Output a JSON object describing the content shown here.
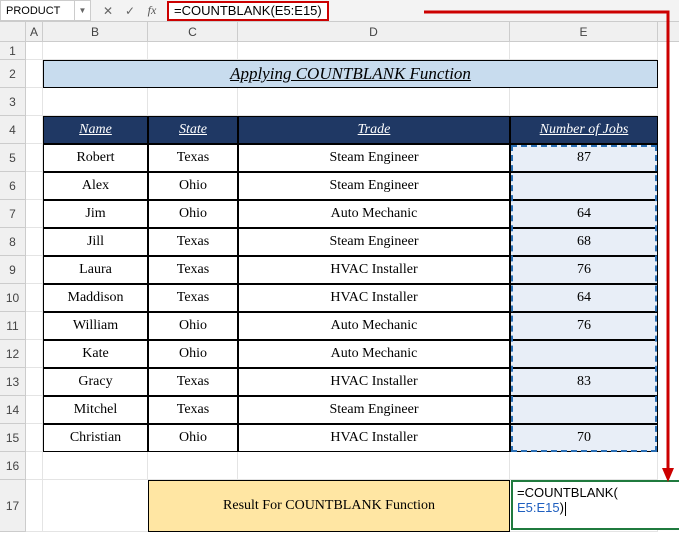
{
  "name_box": "PRODUCT",
  "formula_bar": "=COUNTBLANK(E5:E15)",
  "columns": [
    "A",
    "B",
    "C",
    "D",
    "E"
  ],
  "rows": [
    "1",
    "2",
    "3",
    "4",
    "5",
    "6",
    "7",
    "8",
    "9",
    "10",
    "11",
    "12",
    "13",
    "14",
    "15",
    "16",
    "17"
  ],
  "title": "Applying COUNTBLANK Function",
  "headers": {
    "b": "Name",
    "c": "State",
    "d": "Trade",
    "e": "Number of Jobs"
  },
  "data": [
    {
      "name": "Robert",
      "state": "Texas",
      "trade": "Steam Engineer",
      "jobs": "87"
    },
    {
      "name": "Alex",
      "state": "Ohio",
      "trade": "Steam Engineer",
      "jobs": ""
    },
    {
      "name": "Jim",
      "state": "Ohio",
      "trade": "Auto Mechanic",
      "jobs": "64"
    },
    {
      "name": "Jill",
      "state": "Texas",
      "trade": "Steam Engineer",
      "jobs": "68"
    },
    {
      "name": "Laura",
      "state": "Texas",
      "trade": "HVAC Installer",
      "jobs": "76"
    },
    {
      "name": "Maddison",
      "state": "Texas",
      "trade": "HVAC Installer",
      "jobs": "64"
    },
    {
      "name": "William",
      "state": "Ohio",
      "trade": "Auto Mechanic",
      "jobs": "76"
    },
    {
      "name": "Kate",
      "state": "Ohio",
      "trade": "Auto Mechanic",
      "jobs": ""
    },
    {
      "name": "Gracy",
      "state": "Texas",
      "trade": "HVAC Installer",
      "jobs": "83"
    },
    {
      "name": "Mitchel",
      "state": "Texas",
      "trade": "Steam Engineer",
      "jobs": ""
    },
    {
      "name": "Christian",
      "state": "Ohio",
      "trade": "HVAC Installer",
      "jobs": "70"
    }
  ],
  "result_label": "Result For COUNTBLANK Function",
  "active_cell": {
    "func": "=COUNTBLANK(",
    "ref": "E5:E15",
    "close": ")"
  }
}
